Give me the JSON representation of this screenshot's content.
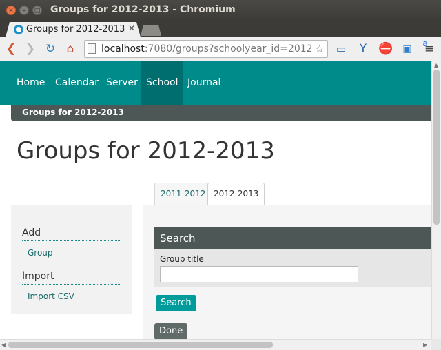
{
  "window": {
    "title": "Groups for 2012-2013 - Chromium"
  },
  "browser": {
    "tab_title": "Groups for 2012-2013",
    "url_host": "localhost",
    "url_rest": ":7080/groups?schoolyear_id=2012",
    "extension_badge": "a"
  },
  "nav": {
    "items": [
      {
        "label": "Home"
      },
      {
        "label": "Calendar"
      },
      {
        "label": "Server"
      },
      {
        "label": "School",
        "active": true
      },
      {
        "label": "Journal"
      }
    ]
  },
  "breadcrumb": "Groups for 2012-2013",
  "page_title": "Groups for 2012-2013",
  "year_tabs": [
    {
      "label": "2011-2012"
    },
    {
      "label": "2012-2013",
      "active": true
    }
  ],
  "sidebar": {
    "sections": [
      {
        "heading": "Add",
        "links": [
          "Group"
        ]
      },
      {
        "heading": "Import",
        "links": [
          "Import CSV"
        ]
      }
    ]
  },
  "search": {
    "heading": "Search",
    "field_label": "Group title",
    "field_value": "",
    "button_label": "Search"
  },
  "done_label": "Done",
  "colors": {
    "nav": "#008b8b",
    "nav_active": "#006d6f",
    "header_dark": "#4d5756",
    "button": "#009b9b"
  }
}
